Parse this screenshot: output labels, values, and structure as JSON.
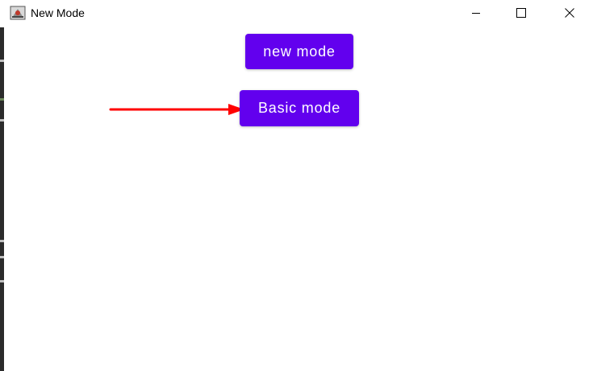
{
  "window": {
    "title": "New Mode",
    "app_icon": "java-app-icon",
    "controls": {
      "minimize_icon": "minimize-icon",
      "maximize_icon": "maximize-icon",
      "close_icon": "close-icon"
    }
  },
  "main": {
    "new_mode_label": "new mode",
    "basic_mode_label": "Basic mode",
    "button_color": "#6200ee",
    "annotation": {
      "type": "arrow",
      "color": "#ff0000",
      "points_to": "basic-mode-button"
    }
  }
}
